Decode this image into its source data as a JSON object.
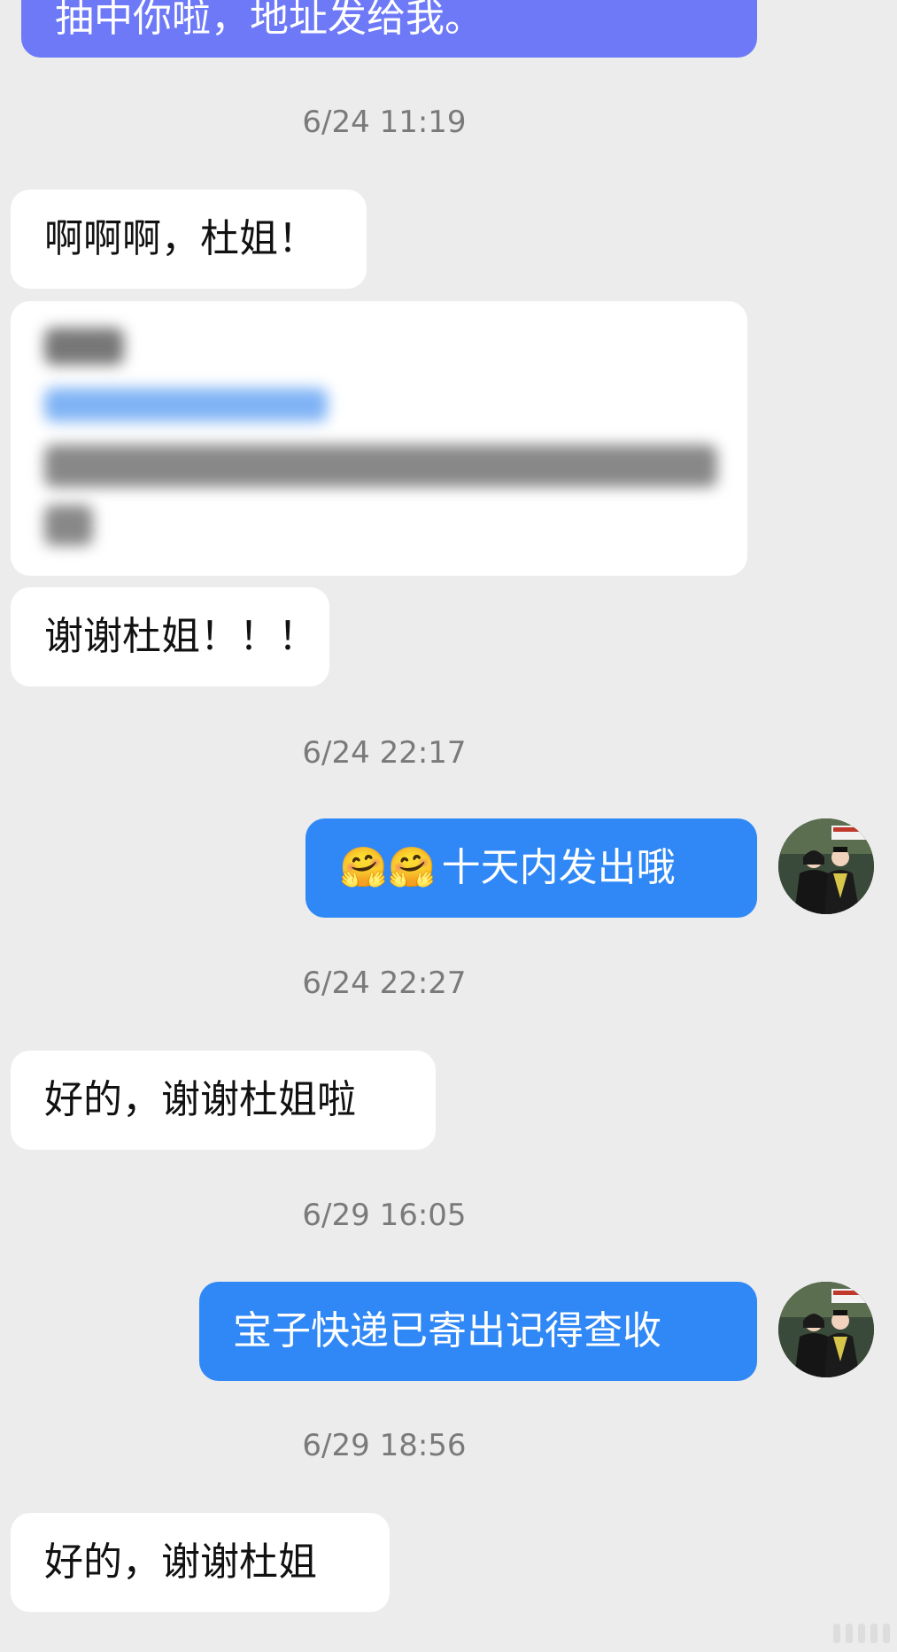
{
  "messages": [
    {
      "type": "outgoing",
      "text": "抽中你啦，地址发给我。"
    },
    {
      "type": "timestamp",
      "text": "6/24 11:19"
    },
    {
      "type": "incoming",
      "text": "啊啊啊，杜姐！"
    },
    {
      "type": "incoming_blurred"
    },
    {
      "type": "incoming",
      "text": "谢谢杜姐！！！"
    },
    {
      "type": "timestamp",
      "text": "6/24 22:17"
    },
    {
      "type": "outgoing",
      "emoji": "🤗🤗",
      "text": "十天内发出哦"
    },
    {
      "type": "timestamp",
      "text": "6/24 22:27"
    },
    {
      "type": "incoming",
      "text": "好的，谢谢杜姐啦"
    },
    {
      "type": "timestamp",
      "text": "6/29 16:05"
    },
    {
      "type": "outgoing",
      "text": "宝子快递已寄出记得查收"
    },
    {
      "type": "timestamp",
      "text": "6/29 18:56"
    },
    {
      "type": "incoming",
      "text": "好的，谢谢杜姐"
    }
  ],
  "colors": {
    "background": "#ececec",
    "incoming_bubble": "#ffffff",
    "outgoing_bubble": "#2f88f6",
    "outgoing_bubble_top": "#6d79f7",
    "timestamp_text": "#7a7a7a"
  },
  "avatar_icon": "graduation-photo-avatar"
}
